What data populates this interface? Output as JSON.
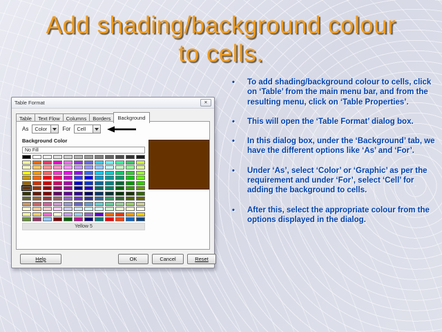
{
  "slide": {
    "title_line1": "Add shading/background colour",
    "title_line2": "to cells.",
    "title_color": "#EE9A1E",
    "text_color": "#0042AD",
    "bullet_char": "•",
    "bullets": [
      "To add shading/background colour to cells, click on ‘Table’ from the main menu bar, and from the resulting menu, click on ‘Table Properties’.",
      "This will open the ‘Table Format’ dialog box.",
      "In this dialog box, under the ‘Background’ tab, we have the different options like ‘As’ and ‘For’.",
      "Under ‘As’, select ‘Color’ or ‘Graphic’ as per the requirement and under ‘For’, select ‘Cell’ for adding the background to cells.",
      "After this, select the appropriate colour from the options displayed in the dialog."
    ]
  },
  "dialog": {
    "window_title": "Table Format",
    "close_glyph": "✕",
    "tabs": [
      "Table",
      "Text Flow",
      "Columns",
      "Borders",
      "Background"
    ],
    "active_tab": "Background",
    "background_tab": {
      "as_label": "As",
      "as_value": "Color",
      "for_label": "For",
      "for_value": "Cell",
      "section_label": "Background Color",
      "no_fill_value": "No Fill",
      "selected_color_name": "Yellow 5",
      "preview_color": "#663300",
      "palette": {
        "selected": {
          "row": 6,
          "col": 0
        },
        "rows": [
          [
            "#000000",
            "#FFFFFF",
            "#EEEEEE",
            "#DEDEDE",
            "#CDCDCD",
            "#B2B2B2",
            "#9A9A9A",
            "#808080",
            "#666666",
            "#4D4D4D",
            "#333333",
            "#1C1C1C"
          ],
          [
            "#FFFF99",
            "#FF6600",
            "#FF3366",
            "#FF00CC",
            "#FF66FF",
            "#9933FF",
            "#6666FF",
            "#33CCFF",
            "#66FFFF",
            "#33FF99",
            "#33CC66",
            "#CCFF33"
          ],
          [
            "#FFFFCC",
            "#FFCC66",
            "#FF9999",
            "#FF99CC",
            "#FF99FF",
            "#CC99FF",
            "#9999FF",
            "#99CCFF",
            "#CCFFFF",
            "#CCFFCC",
            "#99FF99",
            "#E6FF99"
          ],
          [
            "#FFFF00",
            "#FF9900",
            "#FF6666",
            "#FF33CC",
            "#FF00FF",
            "#9900FF",
            "#3366FF",
            "#00CCFF",
            "#00CCCC",
            "#00CC66",
            "#33CC33",
            "#99FF33"
          ],
          [
            "#CC9900",
            "#FF6600",
            "#FF0000",
            "#FF0066",
            "#CC00CC",
            "#3333FF",
            "#0000FF",
            "#0099CC",
            "#009999",
            "#009966",
            "#00CC00",
            "#66FF00"
          ],
          [
            "#996600",
            "#CC3300",
            "#CC0000",
            "#CC0066",
            "#AA00AA",
            "#0000CC",
            "#0033CC",
            "#006699",
            "#008080",
            "#006633",
            "#009900",
            "#33CC00"
          ],
          [
            "#663300",
            "#993300",
            "#990000",
            "#990066",
            "#990099",
            "#000099",
            "#2200CC",
            "#006666",
            "#008066",
            "#006600",
            "#339900",
            "#669900"
          ],
          [
            "#333300",
            "#661A00",
            "#800000",
            "#660066",
            "#660099",
            "#330099",
            "#000066",
            "#003366",
            "#003333",
            "#003300",
            "#1A3300",
            "#336600"
          ],
          [
            "#666633",
            "#996633",
            "#993333",
            "#996666",
            "#9966CC",
            "#6633CC",
            "#333399",
            "#336699",
            "#339966",
            "#336633",
            "#4D6600",
            "#666600"
          ],
          [
            "#CC9966",
            "#CC6666",
            "#CC6699",
            "#CC99CC",
            "#9999CC",
            "#6666CC",
            "#6699CC",
            "#66CCCC",
            "#66CC99",
            "#99CC99",
            "#99CC66",
            "#CCCC99"
          ],
          [
            "#FFFFCC",
            "#FFCC99",
            "#FFCCCC",
            "#FFCCFF",
            "#CCCCFF",
            "#CCE5FF",
            "#CCF2FF",
            "#CCFFF2",
            "#CCFFCC",
            "#E5FFCC",
            "#F2FFCC",
            "#FFFFE0"
          ],
          [
            "#FFFF99",
            "#FFCC66",
            "#FF66CC",
            "#FFFFCC",
            "#CC99FF",
            "#99CCFF",
            "#9966CC",
            "#6600CC",
            "#FF6600",
            "#FF3300",
            "#FF9900",
            "#FFCC00"
          ],
          [
            "#669933",
            "#993366",
            "#99CCFF",
            "#800000",
            "#006600",
            "#CC0099",
            "#000080",
            "#008080",
            "#FF0000",
            "#FF420E",
            "#0066CC",
            "#004586"
          ]
        ]
      }
    },
    "buttons": {
      "help": "Help",
      "ok": "OK",
      "cancel": "Cancel",
      "reset": "Reset"
    }
  }
}
